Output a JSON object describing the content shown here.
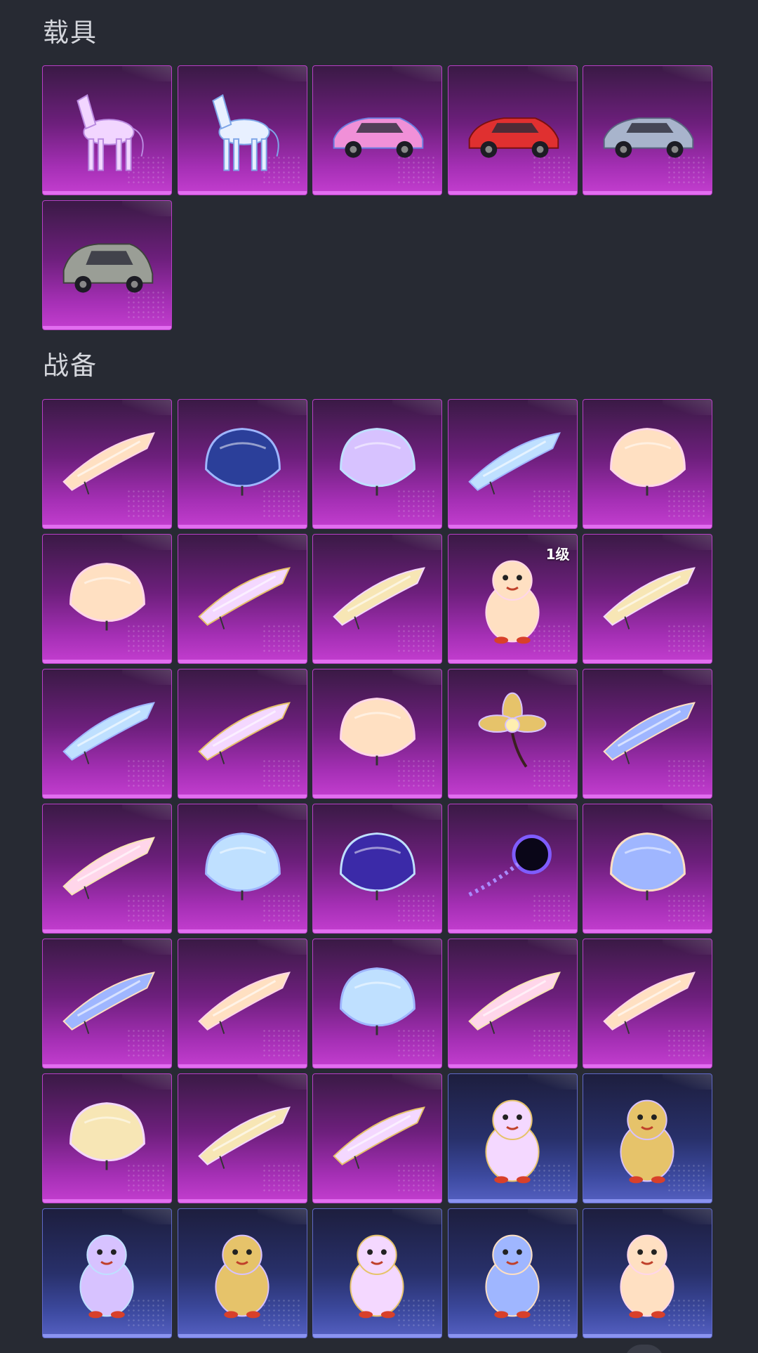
{
  "sections": {
    "vehicles": {
      "title": "载具",
      "items": [
        {
          "icon": "crystal-horse-icon",
          "rarity": "purple"
        },
        {
          "icon": "unicorn-icon",
          "rarity": "purple"
        },
        {
          "icon": "pink-sports-car-icon",
          "rarity": "purple"
        },
        {
          "icon": "red-supercar-icon",
          "rarity": "purple"
        },
        {
          "icon": "silver-sedan-icon",
          "rarity": "purple"
        },
        {
          "icon": "gray-suv-icon",
          "rarity": "purple"
        }
      ]
    },
    "gear": {
      "title": "战备",
      "items": [
        {
          "icon": "silver-glider-icon",
          "rarity": "purple"
        },
        {
          "icon": "blue-mosaic-parachute-icon",
          "rarity": "purple"
        },
        {
          "icon": "crystal-flower-parachute-icon",
          "rarity": "purple"
        },
        {
          "icon": "pink-blue-glider-icon",
          "rarity": "purple"
        },
        {
          "icon": "star-shell-parachute-icon",
          "rarity": "purple"
        },
        {
          "icon": "anime-round-parachute-icon",
          "rarity": "purple"
        },
        {
          "icon": "golden-winged-pet-icon",
          "rarity": "purple"
        },
        {
          "icon": "golden-wing-glider-icon",
          "rarity": "purple"
        },
        {
          "icon": "golden-dragon-icon",
          "rarity": "purple",
          "level": "1级"
        },
        {
          "icon": "pink-heart-glider-icon",
          "rarity": "purple"
        },
        {
          "icon": "red-petal-wings-icon",
          "rarity": "purple"
        },
        {
          "icon": "flame-wings-icon",
          "rarity": "purple"
        },
        {
          "icon": "pink-bow-parachute-icon",
          "rarity": "purple"
        },
        {
          "icon": "ivory-flower-icon",
          "rarity": "purple"
        },
        {
          "icon": "gold-feather-glider-icon",
          "rarity": "purple"
        },
        {
          "icon": "angel-wings-icon",
          "rarity": "purple"
        },
        {
          "icon": "seashell-parachute-icon",
          "rarity": "purple"
        },
        {
          "icon": "galaxy-parachute-icon",
          "rarity": "purple"
        },
        {
          "icon": "black-hole-icon",
          "rarity": "purple"
        },
        {
          "icon": "pink-dome-parachute-icon",
          "rarity": "purple"
        },
        {
          "icon": "swan-wings-icon",
          "rarity": "purple"
        },
        {
          "icon": "blue-leaf-glider-icon",
          "rarity": "purple"
        },
        {
          "icon": "moon-parachute-icon",
          "rarity": "purple"
        },
        {
          "icon": "crystal-shards-icon",
          "rarity": "purple"
        },
        {
          "icon": "pastel-feather-glider-icon",
          "rarity": "purple"
        },
        {
          "icon": "anime-girl-parachute-icon",
          "rarity": "purple"
        },
        {
          "icon": "ornate-wing-glider-icon",
          "rarity": "purple"
        },
        {
          "icon": "blue-white-glider-icon",
          "rarity": "purple"
        },
        {
          "icon": "chicken-sunglasses-icon",
          "rarity": "blue"
        },
        {
          "icon": "chicken-eggshell-icon",
          "rarity": "blue"
        },
        {
          "icon": "pink-bird-icon",
          "rarity": "blue"
        },
        {
          "icon": "bear-robot-icon",
          "rarity": "blue"
        },
        {
          "icon": "tiger-figure-icon",
          "rarity": "blue"
        },
        {
          "icon": "shiba-dog-icon",
          "rarity": "blue"
        },
        {
          "icon": "chicken-helmet-icon",
          "rarity": "blue"
        }
      ]
    }
  }
}
